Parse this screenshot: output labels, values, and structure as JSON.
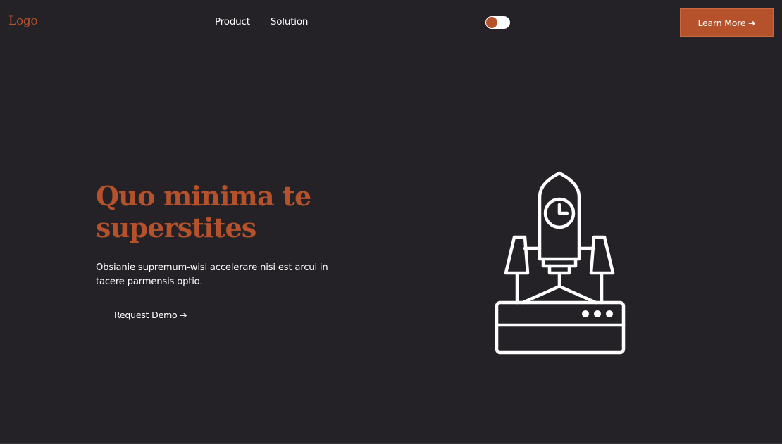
{
  "header": {
    "logo": "Logo",
    "nav": [
      {
        "label": "Product"
      },
      {
        "label": "Solution"
      }
    ],
    "cta_label": "Learn More ➔"
  },
  "hero": {
    "title": "Quo minima te superstites",
    "description": "Obsianie supremum-wisi accelerare nisi est arcui in tacere parmensis optio.",
    "secondary_cta": "Request Demo ➔",
    "illustration_icon": "rocket-launch-icon"
  },
  "theme": {
    "background": "#242226",
    "accent": "#b5522b",
    "text": "#ffffff"
  }
}
